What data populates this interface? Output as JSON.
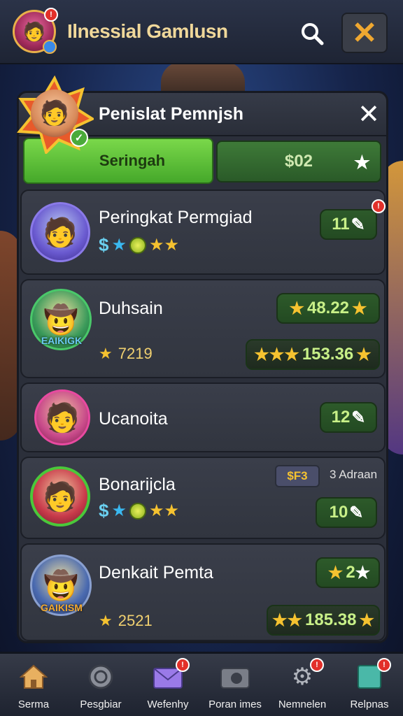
{
  "app": {
    "title": "Ilnessial Gamlusn",
    "avatar_badge": "!"
  },
  "panel": {
    "title": "Penislat Pemnjsh",
    "close_glyph": "✕",
    "tabs": [
      {
        "label": "Seringah",
        "active": true
      },
      {
        "label": "$02",
        "active": false
      }
    ]
  },
  "rows": [
    {
      "name": "Peringkat Permgiad",
      "score": "11",
      "badge": "!",
      "icons": [
        "$",
        "★",
        "coin",
        "★★"
      ]
    },
    {
      "name": "Duhsain",
      "crest_text": "EAIKIGK",
      "top_score": "48.22",
      "sub_score": "7219",
      "bottom_score": "153.36"
    },
    {
      "name": "Ucanoita",
      "score": "12"
    },
    {
      "name": "Bonarijcla",
      "tag_price": "$F3",
      "tag_text": "3 Adraan",
      "score": "10",
      "icons": [
        "$",
        "★",
        "coin",
        "★★"
      ]
    },
    {
      "name": "Denkait Pemta",
      "crest_text": "GAIKISM",
      "top_score": "2",
      "sub_score": "2521",
      "bottom_score": "185.38"
    }
  ],
  "nav": [
    {
      "label": "Serma",
      "icon": "home-icon",
      "badge": ""
    },
    {
      "label": "Pesgbiar",
      "icon": "target-icon",
      "badge": ""
    },
    {
      "label": "Wefenhy",
      "icon": "mail-icon",
      "badge": "!"
    },
    {
      "label": "Poran imes",
      "icon": "camera-icon",
      "badge": ""
    },
    {
      "label": "Nemnelen",
      "icon": "gear-icon",
      "badge": "!"
    },
    {
      "label": "Relpnas",
      "icon": "card-icon",
      "badge": "!"
    }
  ],
  "colors": {
    "accent_green": "#45a82a",
    "gold": "#f5c230",
    "title_gold": "#f0d89a",
    "close_orange": "#f0a830"
  }
}
